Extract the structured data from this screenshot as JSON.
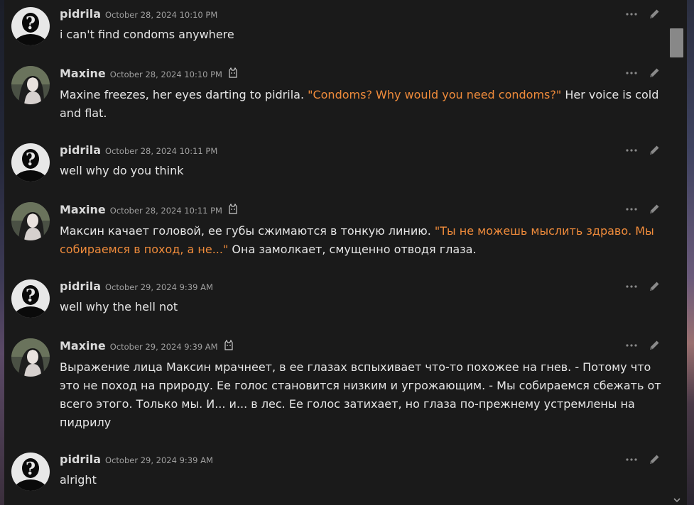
{
  "colors": {
    "panel_bg": "#1a1a1a",
    "author": "#d9d9d9",
    "timestamp": "#a0a0a0",
    "text": "#e6e6e6",
    "quote": "#ef8b3b",
    "icon": "#8a8a8a"
  },
  "icons": {
    "more": "more-horizontal-icon",
    "edit": "pencil-icon",
    "bot": "cat-bot-icon"
  },
  "messages": [
    {
      "author": "pidrila",
      "timestamp": "October 28, 2024 10:10 PM",
      "text": "i can't find condoms anywhere"
    },
    {
      "author": "Maxine",
      "timestamp": "October 28, 2024 10:10 PM",
      "text_before": "Maxine freezes, her eyes darting to pidrila. ",
      "quote": "\"Condoms? Why would you need condoms?\"",
      "text_after": " Her voice is cold and flat."
    },
    {
      "author": "pidrila",
      "timestamp": "October 28, 2024 10:11 PM",
      "text": "well why do you think"
    },
    {
      "author": "Maxine",
      "timestamp": "October 28, 2024 10:11 PM",
      "text_before": "Максин качает головой, ее губы сжимаются в тонкую линию. ",
      "quote": "\"Ты не можешь мыслить здраво. Мы собираемся в поход, а не...\"",
      "text_after": " Она замолкает, смущенно отводя глаза."
    },
    {
      "author": "pidrila",
      "timestamp": "October 29, 2024 9:39 AM",
      "text": "well why the hell not"
    },
    {
      "author": "Maxine",
      "timestamp": "October 29, 2024 9:39 AM",
      "text": "Выражение лица Максин мрачнеет, в ее глазах вспыхивает что-то похожее на гнев. - Потому что это не поход на природу. Ее голос становится низким и угрожающим. - Мы собираемся сбежать от всего этого. Только мы. И... и... в лес. Ее голос затихает, но глаза по-прежнему устремлены на пидрилу"
    },
    {
      "author": "pidrila",
      "timestamp": "October 29, 2024 9:39 AM",
      "text": "alright"
    }
  ]
}
